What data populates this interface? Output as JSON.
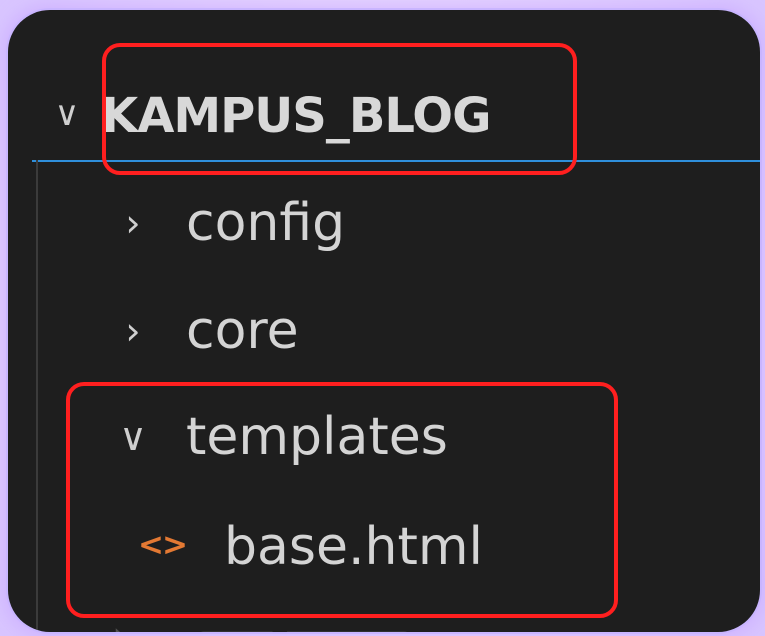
{
  "explorer": {
    "root": {
      "label": "KAMPUS_BLOG",
      "expanded": true,
      "chevron": "chevron-down-icon"
    },
    "items": [
      {
        "label": "config",
        "type": "folder",
        "expanded": false,
        "chevron": "chevron-right-icon"
      },
      {
        "label": "core",
        "type": "folder",
        "expanded": false,
        "chevron": "chevron-right-icon"
      },
      {
        "label": "templates",
        "type": "folder",
        "expanded": true,
        "chevron": "chevron-down-icon",
        "children": [
          {
            "label": "base.html",
            "type": "file",
            "icon": "html-file-icon"
          }
        ]
      }
    ]
  },
  "colors": {
    "background": "#1e1e1e",
    "text": "#d4d4d4",
    "highlight": "#ff1f1f",
    "focus_line": "#2f8fdb",
    "html_icon": "#e37933",
    "glow": "#c9b5ff"
  }
}
